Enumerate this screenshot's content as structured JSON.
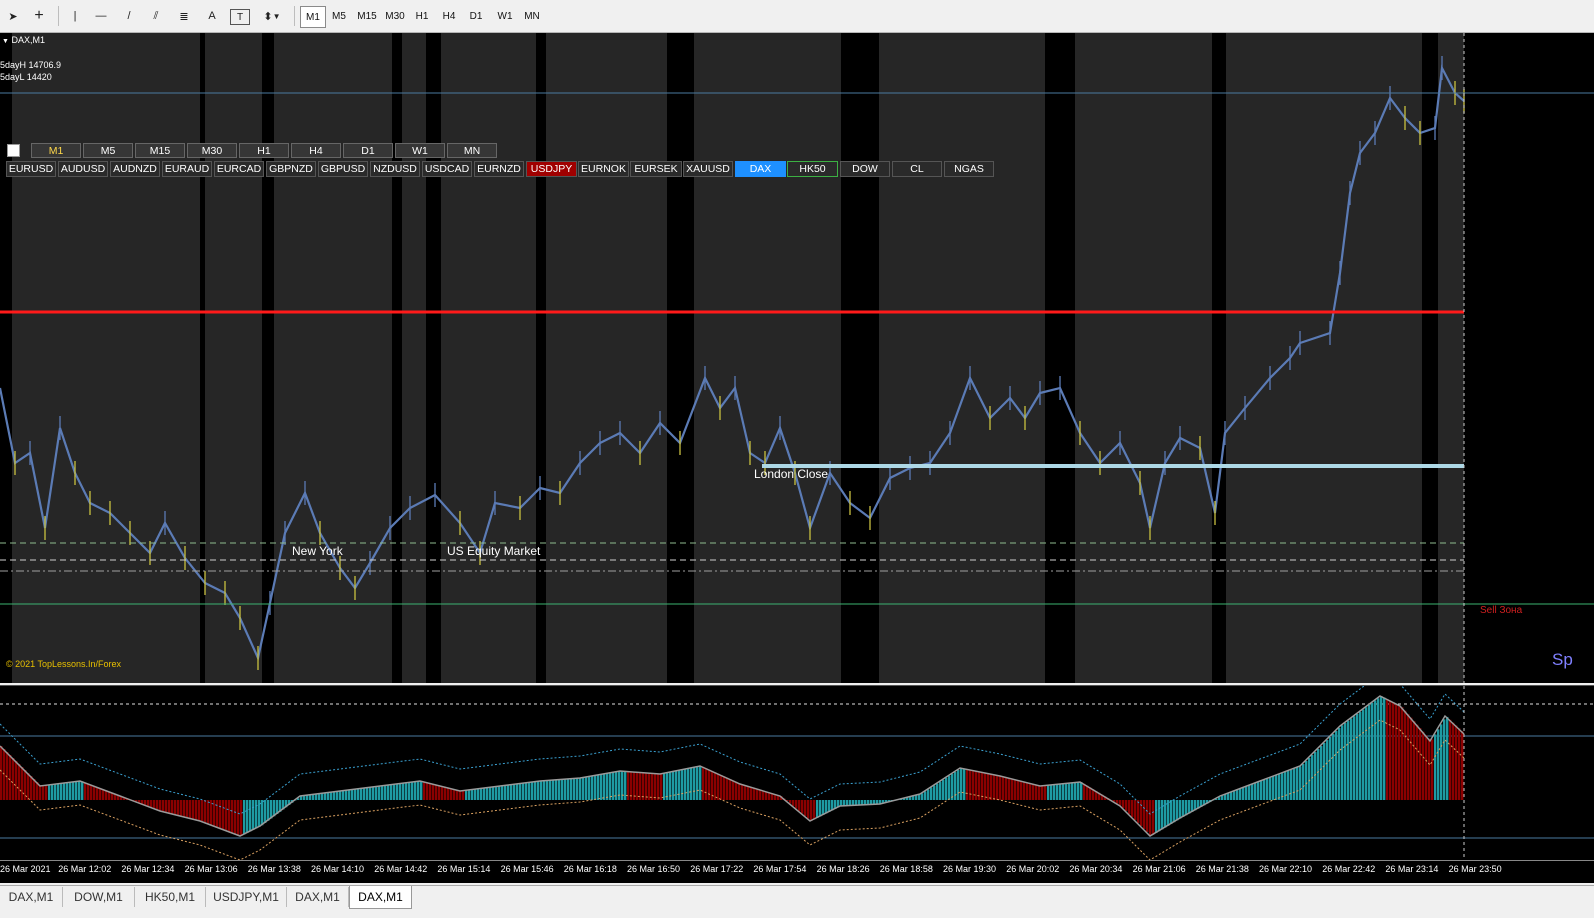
{
  "toolbar": {
    "tools": [
      {
        "name": "cursor-tool",
        "glyph": "➤"
      },
      {
        "name": "crosshair-tool",
        "glyph": "+"
      },
      {
        "name": "vertical-line-tool",
        "glyph": "|"
      },
      {
        "name": "horizontal-line-tool",
        "glyph": "—"
      },
      {
        "name": "trendline-tool",
        "glyph": "/"
      },
      {
        "name": "channel-tool",
        "glyph": "⫽"
      },
      {
        "name": "fibonacci-tool",
        "glyph": "≣"
      },
      {
        "name": "text-tool",
        "glyph": "A"
      },
      {
        "name": "text-label-tool",
        "glyph": "T"
      },
      {
        "name": "arrows-tool",
        "glyph": "⬍"
      }
    ],
    "timeframes": [
      "M1",
      "M5",
      "M15",
      "M30",
      "H1",
      "H4",
      "D1",
      "W1",
      "MN"
    ],
    "active_timeframe": "M1"
  },
  "chart": {
    "symbol_label": "DAX,M1",
    "five_day_high": "5dayH 14706.9",
    "five_day_low": "5dayL 14420",
    "copyright": "© 2021 TopLessons.In/Forex",
    "session_labels": {
      "new_york": "New York",
      "us_equity": "US Equity Market",
      "london_close": "London Close"
    },
    "sell_zone": "Sell Зона",
    "edge_label": "Sp",
    "panel": {
      "timeframe_buttons": [
        "M1",
        "M5",
        "M15",
        "M30",
        "H1",
        "H4",
        "D1",
        "W1",
        "MN"
      ],
      "active_timeframe": "M1",
      "symbols": [
        "EURUSD",
        "AUDUSD",
        "AUDNZD",
        "EURAUD",
        "EURCAD",
        "GBPNZD",
        "GBPUSD",
        "NZDUSD",
        "USDCAD",
        "EURNZD",
        "USDJPY",
        "EURNOK",
        "EURSEK",
        "XAUUSD",
        "DAX",
        "HK50",
        "DOW",
        "CL",
        "NGAS"
      ],
      "highlighted": {
        "USDJPY": "#a00000",
        "DAX": "#1e90ff",
        "HK50": "#2a2a2a"
      }
    },
    "colors": {
      "up_candle": "#5b7bb5",
      "down_candle": "#c8c040",
      "red_line": "#ff1a1a",
      "london_close_line": "#add8e6",
      "session_shade": "#262626",
      "histogram_up": "#1e9ba3",
      "histogram_down": "#8b0000"
    }
  },
  "time_axis": [
    "26 Mar 2021",
    "26 Mar 12:02",
    "26 Mar 12:34",
    "26 Mar 13:06",
    "26 Mar 13:38",
    "26 Mar 14:10",
    "26 Mar 14:42",
    "26 Mar 15:14",
    "26 Mar 15:46",
    "26 Mar 16:18",
    "26 Mar 16:50",
    "26 Mar 17:22",
    "26 Mar 17:54",
    "26 Mar 18:26",
    "26 Mar 18:58",
    "26 Mar 19:30",
    "26 Mar 20:02",
    "26 Mar 20:34",
    "26 Mar 21:06",
    "26 Mar 21:38",
    "26 Mar 22:10",
    "26 Mar 22:42",
    "26 Mar 23:14",
    "26 Mar 23:50"
  ],
  "tabs": [
    "DAX,M1",
    "DOW,M1",
    "HK50,M1",
    "USDJPY,M1",
    "DAX,M1",
    "DAX,M1"
  ],
  "active_tab_index": 5
}
